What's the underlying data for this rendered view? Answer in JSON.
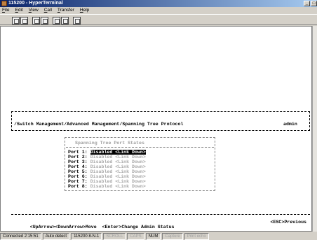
{
  "window": {
    "title": "115200 - HyperTerminal",
    "buttons": [
      "_",
      "□",
      "×"
    ]
  },
  "menu": [
    "File",
    "Edit",
    "View",
    "Call",
    "Transfer",
    "Help"
  ],
  "toolbar": {
    "icons": [
      "new-icon",
      "open-icon",
      "disconnect-icon",
      "properties-icon",
      "send-icon",
      "receive-icon",
      "settings-icon"
    ]
  },
  "terminal": {
    "path": "/Switch Management/Advanced Management/Spanning Tree Protocol",
    "user": "admin",
    "panel_title": "Spanning Tree Port States",
    "ports": [
      {
        "label": "Port",
        "num": "1:",
        "state": "Disabled <Link Down>",
        "selected": true
      },
      {
        "label": "Port",
        "num": "2:",
        "state": "Disabled <Link Down>",
        "selected": false
      },
      {
        "label": "Port",
        "num": "3:",
        "state": "Disabled <Link Down>",
        "selected": false
      },
      {
        "label": "Port",
        "num": "4:",
        "state": "Disabled <Link Down>",
        "selected": false
      },
      {
        "label": "Port",
        "num": "5:",
        "state": "Disabled <Link Down>",
        "selected": false
      },
      {
        "label": "Port",
        "num": "6:",
        "state": "Disabled <Link Down>",
        "selected": false
      },
      {
        "label": "Port",
        "num": "7:",
        "state": "Disabled <Link Down>",
        "selected": false
      },
      {
        "label": "Port",
        "num": "8:",
        "state": "Disabled <Link Down>",
        "selected": false
      }
    ],
    "footer_nav": "<UpArrow><DownArrow>Move  <Enter>Change Admin Status",
    "footer_esc": "<ESC>Previous"
  },
  "statusbar": {
    "connected": "Connected 2:15:51",
    "detect": "Auto detect",
    "settings": "115200 8-N-1",
    "scroll": "SCROLL",
    "caps": "CAPS",
    "num": "NUM",
    "capture": "Capture",
    "print_echo": "Print echo"
  }
}
